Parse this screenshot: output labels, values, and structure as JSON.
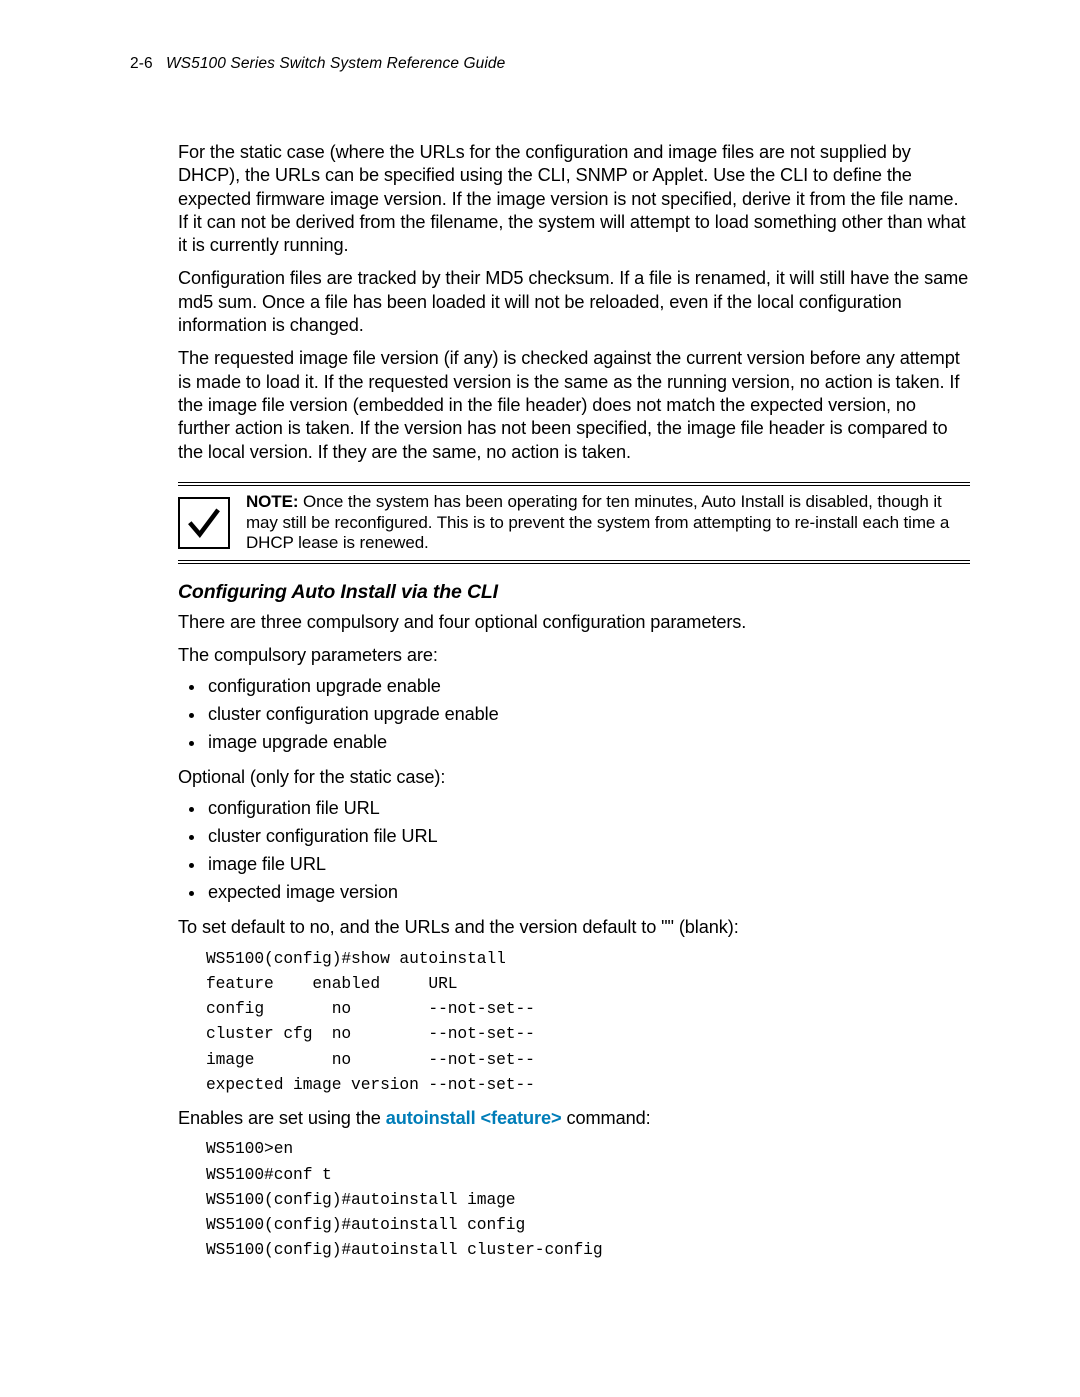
{
  "header": {
    "page_number": "2-6",
    "doc_title": "WS5100 Series Switch System Reference Guide"
  },
  "paragraphs": {
    "p1": "For the static case (where the URLs for the configuration and image files are not supplied by DHCP), the URLs can be specified using the CLI, SNMP or Applet. Use the CLI to define the expected firmware image version. If the image version is not specified, derive it from the file name. If it can not be derived from the filename, the system will attempt to load something other than what it is currently running.",
    "p2": "Configuration files are tracked by their MD5 checksum. If a file is renamed, it will still have the same md5 sum. Once a file has been loaded it will not be reloaded, even if the local configuration information is changed.",
    "p3": "The requested image file version (if any) is checked against the current version before any attempt is made to load it. If the requested version is the same as the running version, no action is taken. If the image file version (embedded in the file header) does not match the expected version, no further action is taken. If the version has not been specified, the image file header is compared to the local version. If they are the same, no action is taken."
  },
  "note": {
    "label": "NOTE:",
    "text": " Once the system has been operating for ten minutes, Auto Install is disabled, though it may still be reconfigured. This is to prevent the system from attempting to re-install each time a DHCP lease is renewed."
  },
  "section": {
    "heading": "Configuring Auto Install via the CLI",
    "intro1": "There are three compulsory and four optional configuration parameters.",
    "intro2": "The compulsory parameters are:",
    "compulsory": [
      "configuration upgrade enable",
      "cluster configuration upgrade enable",
      "image upgrade enable"
    ],
    "optional_intro": "Optional (only for the static case):",
    "optional": [
      "configuration file URL",
      "cluster configuration file URL",
      "image file URL",
      "expected image version"
    ],
    "defaults_line": "To set default to no, and the URLs and the version default to \"\" (blank):",
    "cli1": "WS5100(config)#show autoinstall\nfeature    enabled     URL\nconfig       no        --not-set--\ncluster cfg  no        --not-set--\nimage        no        --not-set--\nexpected image version --not-set--",
    "enables_prefix": "Enables are set using the ",
    "enables_cmd": "autoinstall <feature>",
    "enables_suffix": " command:",
    "cli2": "WS5100>en\nWS5100#conf t\nWS5100(config)#autoinstall image\nWS5100(config)#autoinstall config\nWS5100(config)#autoinstall cluster-config"
  }
}
